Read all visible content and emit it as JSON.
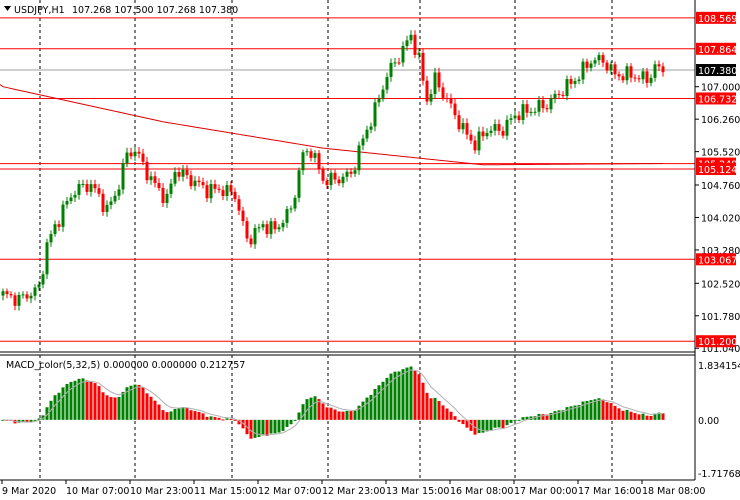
{
  "header": {
    "symbol_title": "USDJPY,H1",
    "ohlc": "107.268 107.500 107.268 107.380"
  },
  "indicator": {
    "title": "MACD_color(5,32,5) 0.000000 0.000000 0.212757",
    "max_label": "1.834154",
    "zero_label": "0.00",
    "min_label": "-1.717685"
  },
  "colors": {
    "bull": "#008000",
    "bear": "#ff0000",
    "level": "#ff0000",
    "ma": "#e00000",
    "grid": "#000000",
    "signal": "#b0b0b0"
  },
  "chart_data": {
    "type": "candlestick",
    "symbol": "USDJPY",
    "timeframe": "H1",
    "ylim": [
      101.0,
      108.93
    ],
    "price_ticks": [
      "107.000",
      "106.260",
      "105.520",
      "104.760",
      "104.020",
      "103.280",
      "102.520",
      "101.780",
      "101.040"
    ],
    "levels": [
      {
        "value": 108.569,
        "label": "108.569"
      },
      {
        "value": 107.864,
        "label": "107.864"
      },
      {
        "value": 106.732,
        "label": "106.732"
      },
      {
        "value": 105.248,
        "label": "105.248"
      },
      {
        "value": 105.124,
        "label": "105.124"
      },
      {
        "value": 103.067,
        "label": "103.067"
      },
      {
        "value": 101.2,
        "label": "101.200"
      }
    ],
    "current_price": {
      "value": 107.38,
      "label": "107.380"
    },
    "x_labels": [
      "9 Mar 2020",
      "10 Mar 07:00",
      "10 Mar 23:00",
      "11 Mar 15:00",
      "12 Mar 07:00",
      "12 Mar 23:00",
      "13 Mar 15:00",
      "16 Mar 08:00",
      "17 Mar 00:00",
      "17 Mar 16:00",
      "18 Mar 08:00"
    ],
    "bar_count": 166,
    "close_anchors": [
      [
        0,
        102.26
      ],
      [
        4,
        102.15
      ],
      [
        9,
        102.4
      ],
      [
        11,
        103.4
      ],
      [
        15,
        104.2
      ],
      [
        18,
        104.65
      ],
      [
        22,
        104.77
      ],
      [
        26,
        104.2
      ],
      [
        28,
        104.5
      ],
      [
        31,
        105.45
      ],
      [
        33,
        105.56
      ],
      [
        37,
        104.88
      ],
      [
        41,
        104.42
      ],
      [
        43,
        105.1
      ],
      [
        47,
        104.88
      ],
      [
        51,
        104.65
      ],
      [
        55,
        104.65
      ],
      [
        58,
        104.54
      ],
      [
        61,
        103.5
      ],
      [
        65,
        103.85
      ],
      [
        68,
        103.74
      ],
      [
        72,
        104.2
      ],
      [
        75,
        105.45
      ],
      [
        77,
        105.56
      ],
      [
        80,
        104.88
      ],
      [
        83,
        104.88
      ],
      [
        87,
        105.0
      ],
      [
        90,
        105.8
      ],
      [
        93,
        106.47
      ],
      [
        96,
        107.27
      ],
      [
        100,
        107.84
      ],
      [
        102,
        108.18
      ],
      [
        104,
        107.6
      ],
      [
        106,
        106.7
      ],
      [
        108,
        107.16
      ],
      [
        111,
        106.7
      ],
      [
        115,
        106.02
      ],
      [
        118,
        105.68
      ],
      [
        121,
        106.02
      ],
      [
        125,
        106.02
      ],
      [
        128,
        106.36
      ],
      [
        132,
        106.47
      ],
      [
        136,
        106.59
      ],
      [
        140,
        106.93
      ],
      [
        143,
        107.16
      ],
      [
        147,
        107.6
      ],
      [
        150,
        107.6
      ],
      [
        153,
        107.27
      ],
      [
        157,
        107.27
      ],
      [
        161,
        107.16
      ],
      [
        163,
        107.43
      ],
      [
        165,
        107.38
      ]
    ],
    "ma_anchors": [
      [
        0,
        107.0
      ],
      [
        40,
        106.2
      ],
      [
        80,
        105.6
      ],
      [
        120,
        105.22
      ],
      [
        165,
        105.25
      ]
    ],
    "macd": {
      "fast": 5,
      "slow": 32,
      "signal": 5,
      "ylim": [
        -1.717685,
        1.834154
      ]
    }
  }
}
